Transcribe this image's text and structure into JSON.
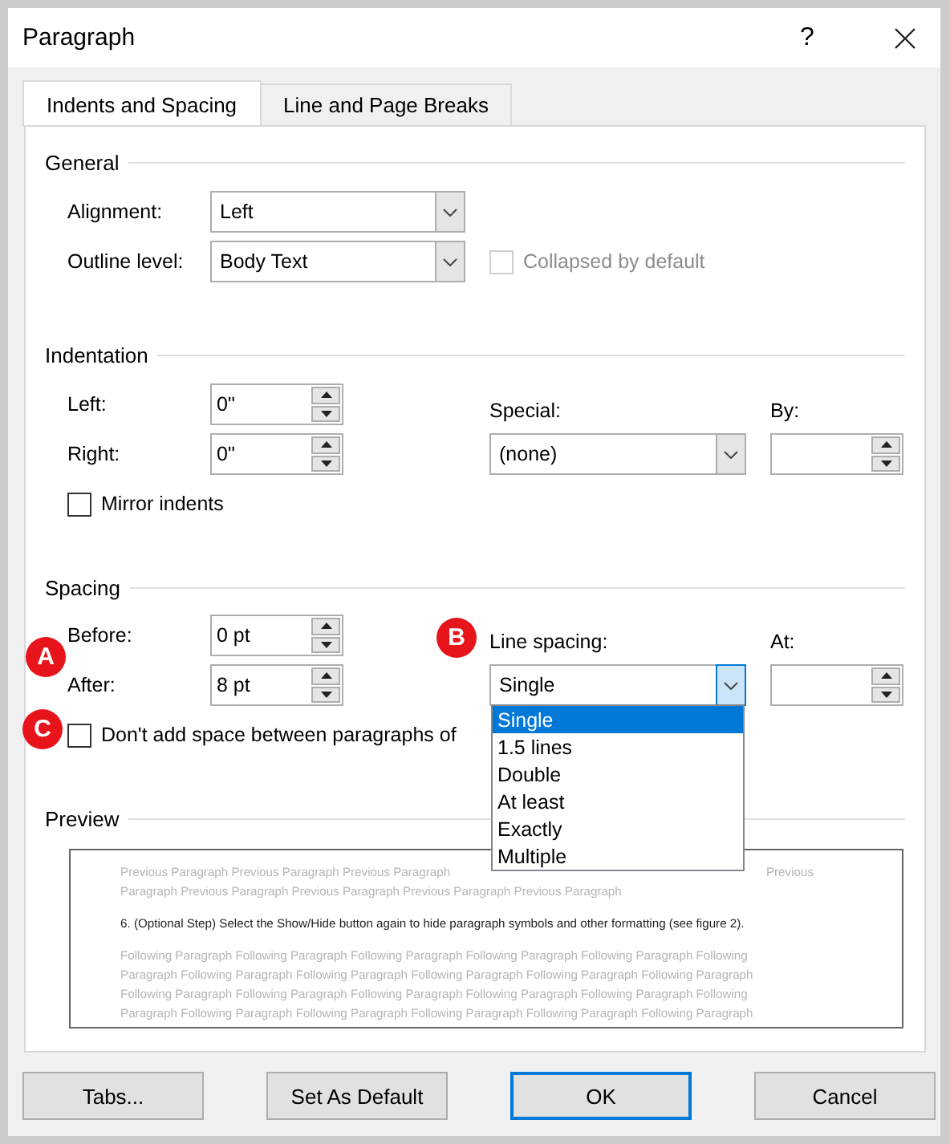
{
  "window": {
    "title": "Paragraph",
    "help": "?"
  },
  "tabs": [
    {
      "label": "Indents and Spacing",
      "selected": true
    },
    {
      "label": "Line and Page Breaks",
      "selected": false
    }
  ],
  "general": {
    "heading": "General",
    "alignment": {
      "label": "Alignment:",
      "value": "Left"
    },
    "outline_level": {
      "label": "Outline level:",
      "value": "Body Text"
    },
    "collapsed": {
      "label": "Collapsed by default",
      "checked": false,
      "disabled": true
    }
  },
  "indentation": {
    "heading": "Indentation",
    "left": {
      "label": "Left:",
      "value": "0\""
    },
    "right": {
      "label": "Right:",
      "value": "0\""
    },
    "special": {
      "label": "Special:",
      "value": "(none)"
    },
    "by": {
      "label": "By:"
    },
    "mirror_indents": {
      "label": "Mirror indents",
      "checked": false
    }
  },
  "spacing": {
    "heading": "Spacing",
    "before": {
      "label": "Before:",
      "value": "0 pt"
    },
    "after": {
      "label": "After:",
      "value": "8 pt"
    },
    "line_spacing": {
      "label": "Line spacing:",
      "value": "Single",
      "expanded": true,
      "options": [
        {
          "label": "Single",
          "selected": true
        },
        {
          "label": "1.5 lines",
          "selected": false
        },
        {
          "label": "Double",
          "selected": false
        },
        {
          "label": "At least",
          "selected": false
        },
        {
          "label": "Exactly",
          "selected": false
        },
        {
          "label": "Multiple",
          "selected": false
        }
      ]
    },
    "at": {
      "label": "At:"
    },
    "dont_add_space": {
      "label": "Don't add space between paragraphs of",
      "checked": false
    }
  },
  "preview": {
    "heading": "Preview",
    "previous_lines": [
      [
        "Previous Paragraph Previous Paragraph Previous Paragraph",
        "Previous"
      ],
      [
        "Paragraph Previous Paragraph Previous Paragraph Previous Paragraph Previous Paragraph"
      ]
    ],
    "current": "6. (Optional Step) Select the Show/Hide button again to hide paragraph symbols and other formatting (see figure 2).",
    "following_lines": [
      "Following Paragraph Following Paragraph Following Paragraph Following Paragraph Following Paragraph Following",
      "Paragraph Following Paragraph Following Paragraph Following Paragraph Following Paragraph Following Paragraph",
      "Following Paragraph Following Paragraph Following Paragraph Following Paragraph Following Paragraph Following",
      "Paragraph Following Paragraph Following Paragraph Following Paragraph Following Paragraph Following Paragraph"
    ]
  },
  "buttons": [
    {
      "label": "Tabs...",
      "default": false
    },
    {
      "label": "Set As Default",
      "default": false
    },
    {
      "label": "OK",
      "default": true
    },
    {
      "label": "Cancel",
      "default": false
    }
  ],
  "callouts": [
    {
      "label": "A",
      "kind": "a"
    },
    {
      "label": "B",
      "kind": "b"
    },
    {
      "label": "C",
      "kind": "c"
    }
  ]
}
